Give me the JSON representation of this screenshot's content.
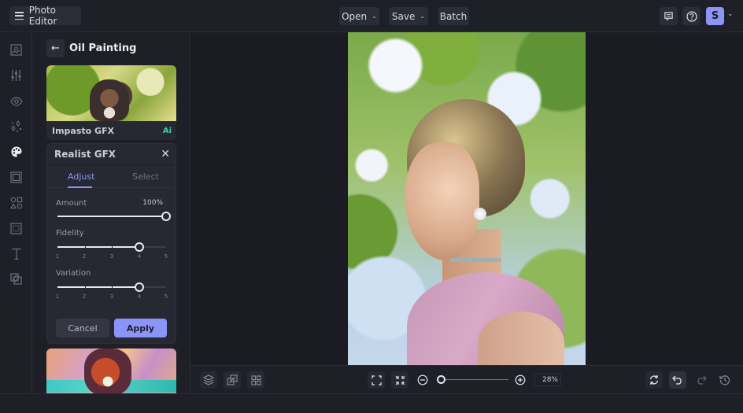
{
  "app": {
    "title": "Photo Editor"
  },
  "topbar": {
    "open_label": "Open",
    "save_label": "Save",
    "batch_label": "Batch",
    "avatar_initial": "S"
  },
  "rail": {
    "items": [
      {
        "icon": "image-icon"
      },
      {
        "icon": "sliders-icon"
      },
      {
        "icon": "eye-icon"
      },
      {
        "icon": "sparkles-icon"
      },
      {
        "icon": "palette-icon",
        "active": true
      },
      {
        "icon": "frame-icon"
      },
      {
        "icon": "shapes-icon"
      },
      {
        "icon": "texture-icon"
      },
      {
        "icon": "text-icon"
      },
      {
        "icon": "overlay-icon"
      }
    ]
  },
  "panel": {
    "title": "Oil Painting",
    "effects": [
      {
        "name": "Impasto GFX",
        "badge": "Ai"
      },
      {
        "name": "Realist GFX"
      }
    ],
    "active_effect": {
      "name": "Realist GFX",
      "tabs": [
        {
          "label": "Adjust",
          "active": true
        },
        {
          "label": "Select",
          "active": false
        }
      ],
      "amount": {
        "label": "Amount",
        "value_text": "100%",
        "value": 100,
        "max": 100
      },
      "fidelity": {
        "label": "Fidelity",
        "value": 4,
        "ticks": [
          "1",
          "2",
          "3",
          "4",
          "5"
        ]
      },
      "variation": {
        "label": "Variation",
        "value": 4,
        "ticks": [
          "1",
          "2",
          "3",
          "4",
          "5"
        ]
      },
      "cancel_label": "Cancel",
      "apply_label": "Apply"
    }
  },
  "canvas": {
    "zoom_text": "28%",
    "zoom_value": 28
  },
  "colors": {
    "accent": "#8b95f7",
    "ai_badge": "#3fd3a6",
    "background": "#1e1f27",
    "surface": "#262832"
  }
}
